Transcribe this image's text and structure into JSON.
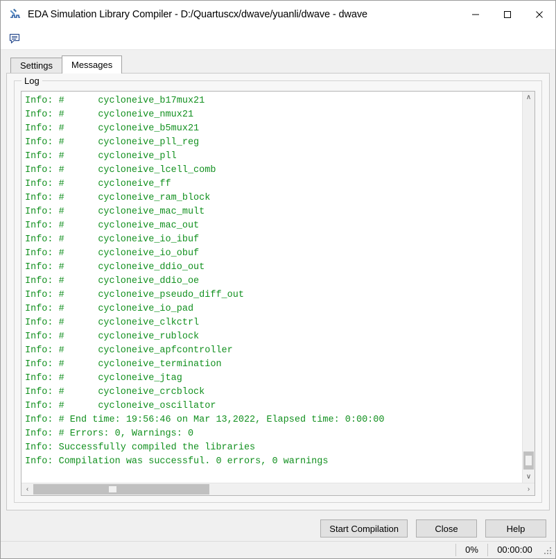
{
  "window": {
    "title": "EDA Simulation Library Compiler - D:/Quartuscx/dwave/yuanli/dwave - dwave",
    "app_icon": "hammer-waveform-icon",
    "minimize_label": "—",
    "maximize_label": "□",
    "close_label": "✕"
  },
  "toolstrip": {
    "message_icon": "message-bubble-icon"
  },
  "tabs": [
    {
      "label": "Settings",
      "active": false
    },
    {
      "label": "Messages",
      "active": true
    }
  ],
  "groupbox": {
    "label": "Log"
  },
  "log": {
    "lines": [
      "Info: #      cycloneive_b17mux21",
      "Info: #      cycloneive_nmux21",
      "Info: #      cycloneive_b5mux21",
      "Info: #      cycloneive_pll_reg",
      "Info: #      cycloneive_pll",
      "Info: #      cycloneive_lcell_comb",
      "Info: #      cycloneive_ff",
      "Info: #      cycloneive_ram_block",
      "Info: #      cycloneive_mac_mult",
      "Info: #      cycloneive_mac_out",
      "Info: #      cycloneive_io_ibuf",
      "Info: #      cycloneive_io_obuf",
      "Info: #      cycloneive_ddio_out",
      "Info: #      cycloneive_ddio_oe",
      "Info: #      cycloneive_pseudo_diff_out",
      "Info: #      cycloneive_io_pad",
      "Info: #      cycloneive_clkctrl",
      "Info: #      cycloneive_rublock",
      "Info: #      cycloneive_apfcontroller",
      "Info: #      cycloneive_termination",
      "Info: #      cycloneive_jtag",
      "Info: #      cycloneive_crcblock",
      "Info: #      cycloneive_oscillator",
      "Info: # End time: 19:56:46 on Mar 13,2022, Elapsed time: 0:00:00",
      "Info: # Errors: 0, Warnings: 0",
      "Info: Successfully compiled the libraries",
      "Info: Compilation was successful. 0 errors, 0 warnings"
    ],
    "text_color": "#12901f",
    "background_color": "#ffffff"
  },
  "scrollbars": {
    "vertical_up": "∧",
    "vertical_down": "∨",
    "horizontal_left": "‹",
    "horizontal_right": "›"
  },
  "buttons": [
    {
      "label": "Start Compilation"
    },
    {
      "label": "Close"
    },
    {
      "label": "Help"
    }
  ],
  "statusbar": {
    "progress": "0%",
    "elapsed": "00:00:00"
  }
}
